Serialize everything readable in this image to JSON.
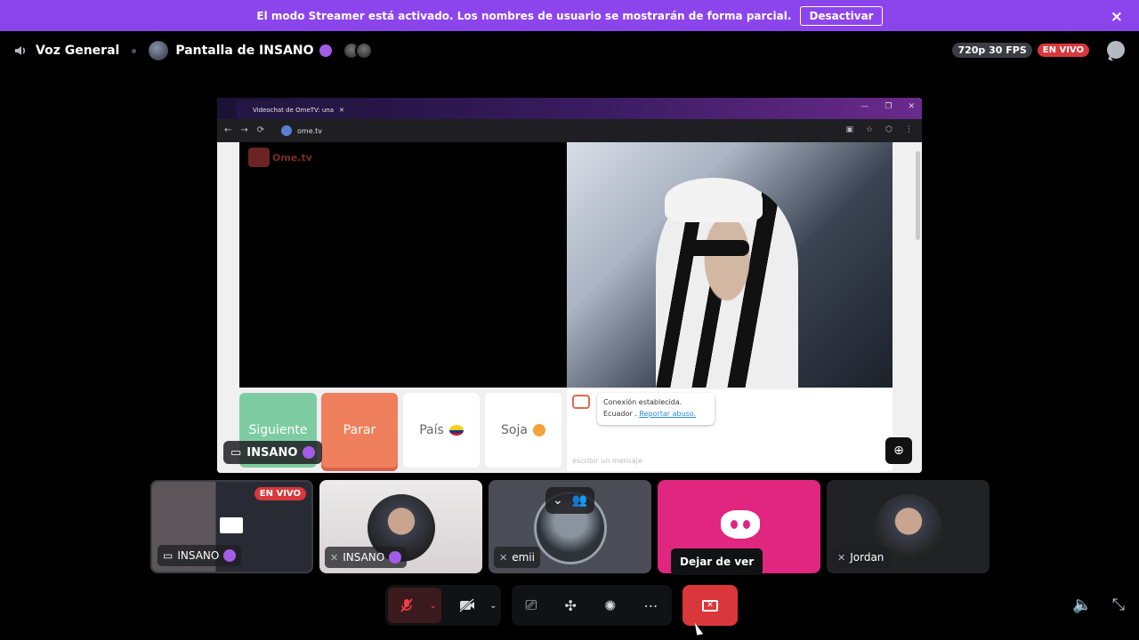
{
  "banner": {
    "message": "El modo Streamer está activado. Los nombres de usuario se mostrarán de forma parcial.",
    "button_label": "Desactivar",
    "close_icon": "×"
  },
  "header": {
    "channel_name": "Voz General",
    "stream_title": "Pantalla de INSANO",
    "quality": "720p 30 FPS",
    "live_label": "EN VIVO"
  },
  "stream": {
    "browser_tab_title": "Videochat de OmeTV: una",
    "url": "ome.tv",
    "site_logo": "Ome.tv",
    "buttons": {
      "next": "Siguiente",
      "stop": "Parar",
      "country": "País",
      "gender": "Soja"
    },
    "chat": {
      "connected": "Conexión establecida.",
      "country": "Ecuador .",
      "report": "Reportar abuso.",
      "input_placeholder": "escribir un mensaje"
    },
    "streamer_label": "INSANO"
  },
  "tiles": [
    {
      "name": "INSANO",
      "live": "EN VIVO"
    },
    {
      "name": "INSANO"
    },
    {
      "name": "emii"
    },
    {
      "name": ""
    },
    {
      "name": "Jordan"
    }
  ],
  "tooltip": "Dejar de ver",
  "colors": {
    "banner": "#8c45ec",
    "live": "#da373c",
    "discord_pink": "#e0267f"
  }
}
